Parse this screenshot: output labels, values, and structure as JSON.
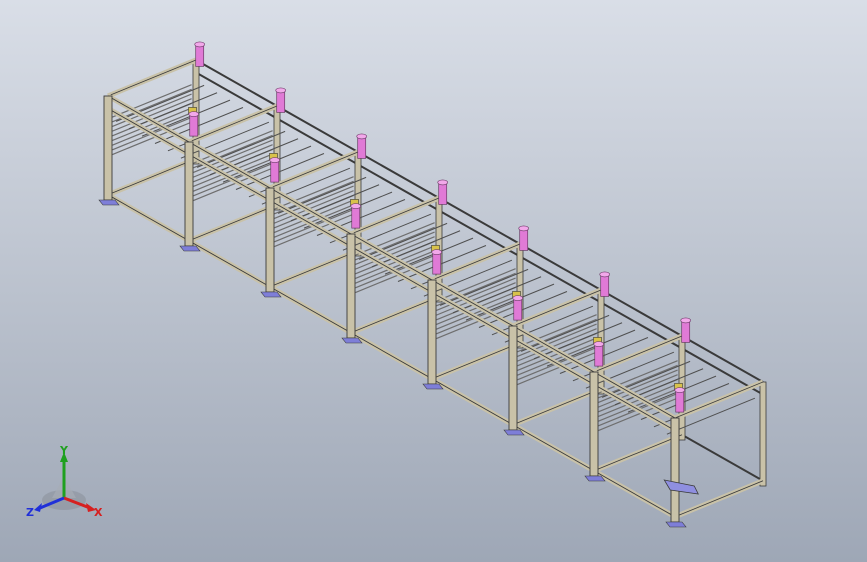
{
  "viewport": {
    "background_top": "#d9dee7",
    "background_bottom": "#9ea7b6"
  },
  "model": {
    "description_icon": "rack-conveyor-assembly-icon",
    "module_count": 7,
    "frame_color": "#c9c2a8",
    "frame_edge_color": "#3a3a3a",
    "cylinder_color": "#e07ad6",
    "foot_color": "#7e7ed8",
    "roller_color": "#6e6e6e"
  },
  "triad": {
    "labels": {
      "x": "X",
      "y": "Y",
      "z": "Z"
    },
    "colors": {
      "x": "#d62020",
      "y": "#1fa01f",
      "z": "#2030d8"
    }
  }
}
